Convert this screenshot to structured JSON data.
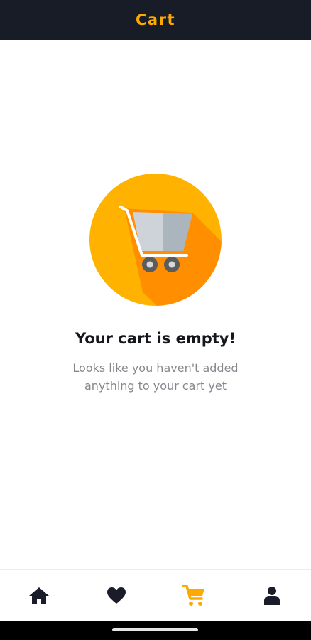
{
  "header": {
    "title": "Cart"
  },
  "empty_state": {
    "illustration_icon": "empty-cart-icon",
    "title": "Your cart is empty!",
    "message": "Looks like you haven't added anything to your cart yet"
  },
  "bottom_nav": {
    "items": [
      {
        "icon": "home-icon",
        "active": false
      },
      {
        "icon": "heart-icon",
        "active": false
      },
      {
        "icon": "cart-icon",
        "active": true
      },
      {
        "icon": "user-icon",
        "active": false
      }
    ]
  },
  "colors": {
    "header_background": "#181c26",
    "accent": "#ffa800",
    "illustration_circle": "#ffb300",
    "illustration_shadow": "#ff8f00",
    "text_primary": "#15171c",
    "text_secondary": "#85878c",
    "nav_icon_inactive": "#1a1d29"
  }
}
